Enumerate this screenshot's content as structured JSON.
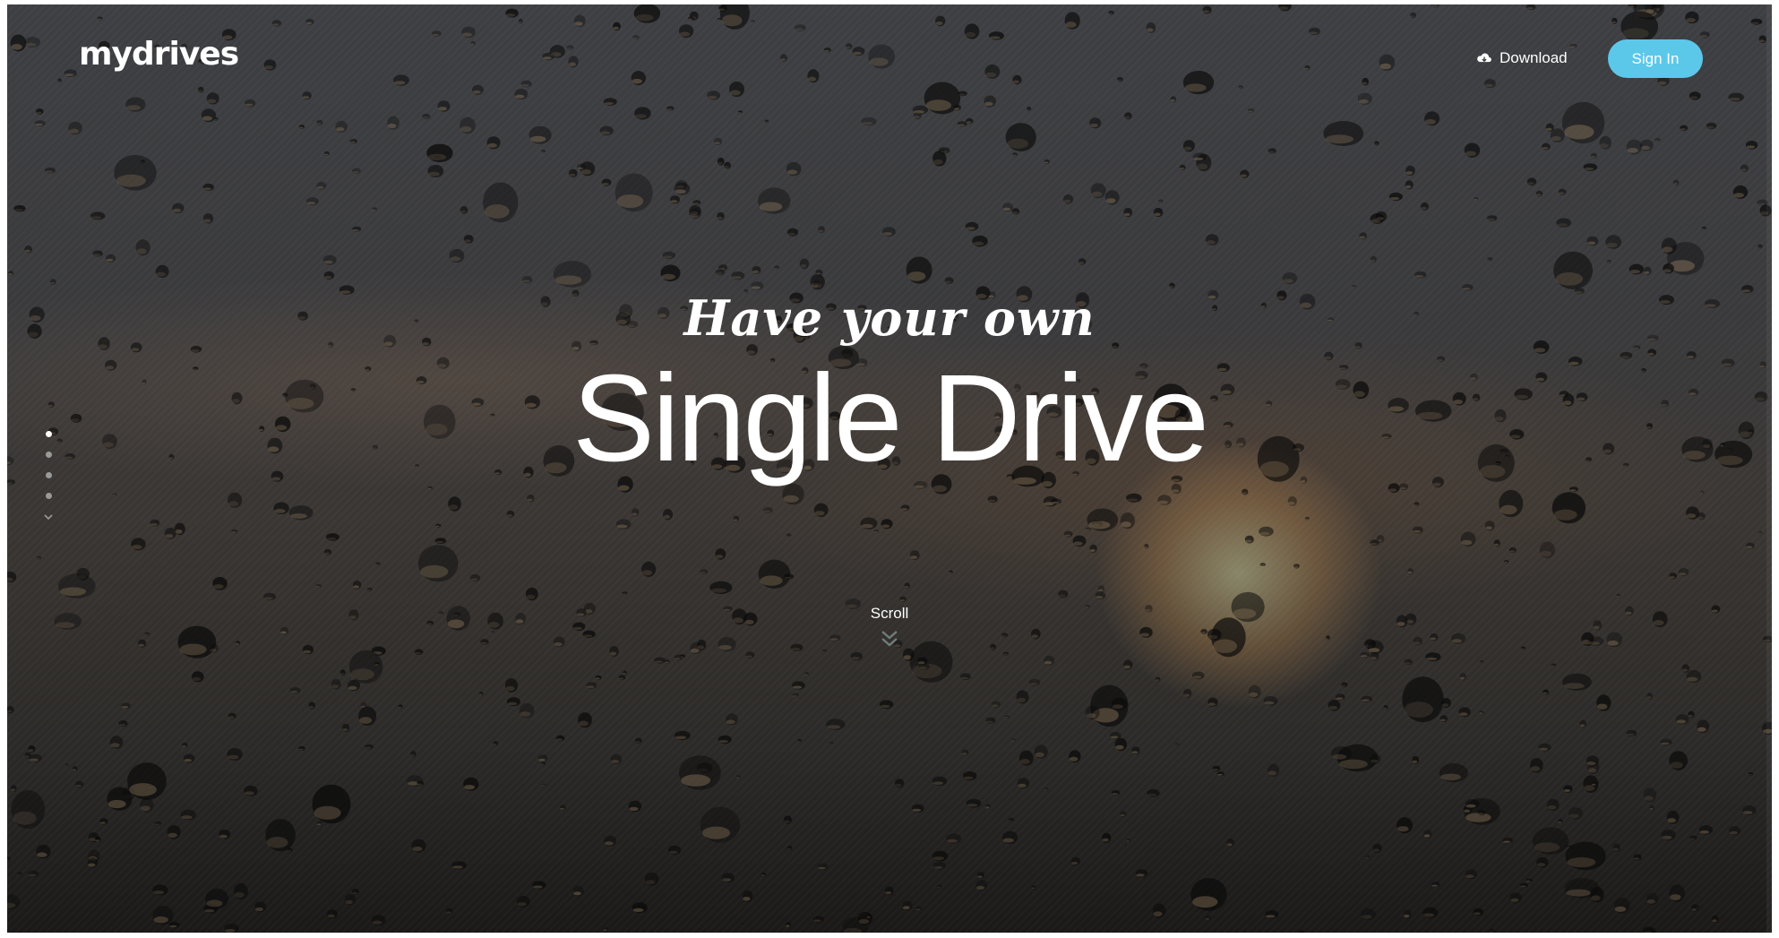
{
  "brand": {
    "logo_text": "mydrives"
  },
  "nav": {
    "download_label": "Download",
    "signin_label": "Sign In"
  },
  "hero": {
    "script_line": "Have your own",
    "title_line": "Single Drive",
    "scroll_label": "Scroll"
  },
  "pager": {
    "dot_count": 4,
    "active_index": 0
  },
  "icons": {
    "download": "cloud-download-icon",
    "scroll": "chevron-down-icon",
    "pager_more": "chevron-down-icon"
  },
  "colors": {
    "accent": "#5bc8ea",
    "text": "#ffffff",
    "dot_inactive": "#9a9a9a"
  }
}
